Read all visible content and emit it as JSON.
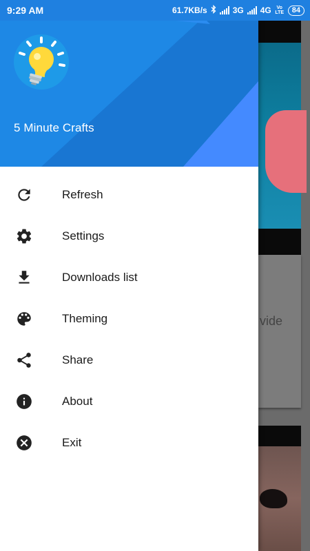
{
  "status_bar": {
    "time": "9:29 AM",
    "network_speed": "61.7KB/s",
    "net_3g": "3G",
    "net_4g": "4G",
    "volte": "Vo LTE",
    "battery": "84"
  },
  "drawer": {
    "app_name": "5 Minute Crafts",
    "colors": {
      "header": "#1e88e5",
      "header_dark": "#1976d2",
      "accent": "#448aff"
    },
    "menu": [
      {
        "label": "Refresh",
        "icon": "refresh-icon"
      },
      {
        "label": "Settings",
        "icon": "gear-icon"
      },
      {
        "label": "Downloads list",
        "icon": "download-icon"
      },
      {
        "label": "Theming",
        "icon": "palette-icon"
      },
      {
        "label": "Share",
        "icon": "share-icon"
      },
      {
        "label": "About",
        "icon": "info-icon"
      },
      {
        "label": "Exit",
        "icon": "close-circle-icon"
      }
    ]
  },
  "background": {
    "partial_text": "vide"
  }
}
